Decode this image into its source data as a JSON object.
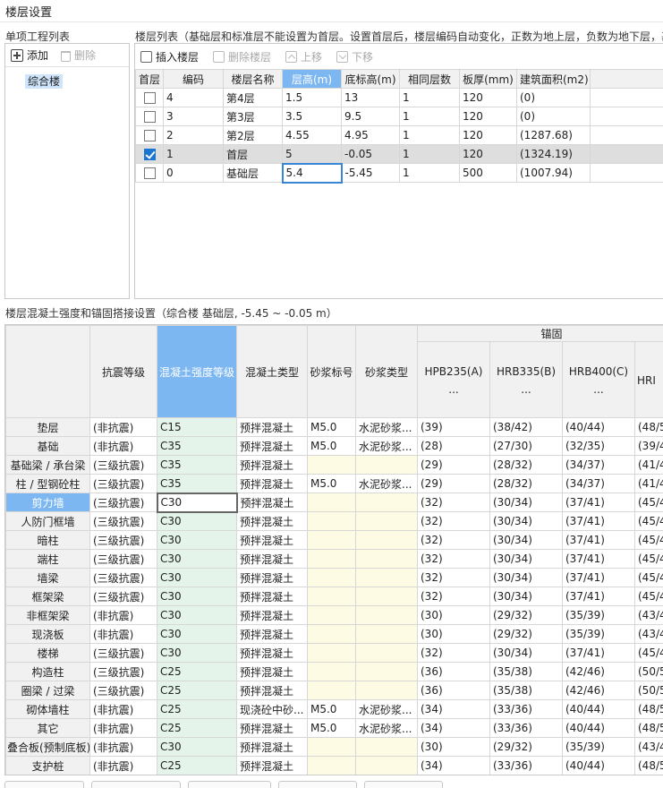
{
  "window": {
    "title": "楼层设置"
  },
  "left_panel": {
    "label": "单项工程列表",
    "add_label": "添加",
    "delete_label": "删除",
    "items": [
      "综合楼"
    ]
  },
  "floor_panel": {
    "label": "楼层列表（基础层和标准层不能设置为首层。设置首层后，楼层编码自动变化，正数为地上层，负数为地下层，基",
    "toolbar": {
      "insert": "插入楼层",
      "delete": "删除楼层",
      "up": "上移",
      "down": "下移"
    },
    "headers": [
      "首层",
      "编码",
      "楼层名称",
      "层高(m)",
      "底标高(m)",
      "相同层数",
      "板厚(mm)",
      "建筑面积(m2)"
    ],
    "rows": [
      {
        "first": false,
        "code": "4",
        "name": "第4层",
        "height": "1.5",
        "base": "13",
        "same": "1",
        "slab": "120",
        "area": "(0)"
      },
      {
        "first": false,
        "code": "3",
        "name": "第3层",
        "height": "3.5",
        "base": "9.5",
        "same": "1",
        "slab": "120",
        "area": "(0)"
      },
      {
        "first": false,
        "code": "2",
        "name": "第2层",
        "height": "4.55",
        "base": "4.95",
        "same": "1",
        "slab": "120",
        "area": "(1287.68)"
      },
      {
        "first": true,
        "code": "1",
        "name": "首层",
        "height": "5",
        "base": "-0.05",
        "same": "1",
        "slab": "120",
        "area": "(1324.19)"
      },
      {
        "first": false,
        "code": "0",
        "name": "基础层",
        "height": "5.4",
        "base": "-5.45",
        "same": "1",
        "slab": "500",
        "area": "(1007.94)"
      }
    ]
  },
  "concrete": {
    "label": "楼层混凝土强度和锚固搭接设置（综合楼  基础层, -5.45 ~ -0.05 m）",
    "group_header": "锚固",
    "headers": [
      "抗震等级",
      "混凝土强度等级",
      "混凝土类型",
      "砂浆标号",
      "砂浆类型",
      "HPB235(A)\n...",
      "HRB335(B)\n...",
      "HRB400(C)\n...",
      "HRI"
    ],
    "rows": [
      [
        "垫层",
        "(非抗震)",
        "C15",
        "预拌混凝土",
        "M5.0",
        "水泥砂浆...",
        "(39)",
        "(38/42)",
        "(40/44)",
        "(48/5"
      ],
      [
        "基础",
        "(非抗震)",
        "C35",
        "预拌混凝土",
        "M5.0",
        "水泥砂浆...",
        "(28)",
        "(27/30)",
        "(32/35)",
        "(39/4"
      ],
      [
        "基础梁 / 承台梁",
        "(三级抗震)",
        "C35",
        "预拌混凝土",
        "",
        "",
        "(29)",
        "(28/32)",
        "(34/37)",
        "(41/4"
      ],
      [
        "柱 / 型钢砼柱",
        "(三级抗震)",
        "C35",
        "预拌混凝土",
        "M5.0",
        "水泥砂浆...",
        "(29)",
        "(28/32)",
        "(34/37)",
        "(41/4"
      ],
      [
        "剪力墙",
        "(三级抗震)",
        "C30",
        "预拌混凝土",
        "",
        "",
        "(32)",
        "(30/34)",
        "(37/41)",
        "(45/4"
      ],
      [
        "人防门框墙",
        "(三级抗震)",
        "C30",
        "预拌混凝土",
        "",
        "",
        "(32)",
        "(30/34)",
        "(37/41)",
        "(45/4"
      ],
      [
        "暗柱",
        "(三级抗震)",
        "C30",
        "预拌混凝土",
        "",
        "",
        "(32)",
        "(30/34)",
        "(37/41)",
        "(45/4"
      ],
      [
        "端柱",
        "(三级抗震)",
        "C30",
        "预拌混凝土",
        "",
        "",
        "(32)",
        "(30/34)",
        "(37/41)",
        "(45/4"
      ],
      [
        "墙梁",
        "(三级抗震)",
        "C30",
        "预拌混凝土",
        "",
        "",
        "(32)",
        "(30/34)",
        "(37/41)",
        "(45/4"
      ],
      [
        "框架梁",
        "(三级抗震)",
        "C30",
        "预拌混凝土",
        "",
        "",
        "(32)",
        "(30/34)",
        "(37/41)",
        "(45/4"
      ],
      [
        "非框架梁",
        "(非抗震)",
        "C30",
        "预拌混凝土",
        "",
        "",
        "(30)",
        "(29/32)",
        "(35/39)",
        "(43/4"
      ],
      [
        "现浇板",
        "(非抗震)",
        "C30",
        "预拌混凝土",
        "",
        "",
        "(30)",
        "(29/32)",
        "(35/39)",
        "(43/4"
      ],
      [
        "楼梯",
        "(三级抗震)",
        "C30",
        "预拌混凝土",
        "",
        "",
        "(32)",
        "(30/34)",
        "(37/41)",
        "(45/4"
      ],
      [
        "构造柱",
        "(三级抗震)",
        "C25",
        "预拌混凝土",
        "",
        "",
        "(36)",
        "(35/38)",
        "(42/46)",
        "(50/5"
      ],
      [
        "圈梁 / 过梁",
        "(三级抗震)",
        "C25",
        "预拌混凝土",
        "",
        "",
        "(36)",
        "(35/38)",
        "(42/46)",
        "(50/5"
      ],
      [
        "砌体墙柱",
        "(非抗震)",
        "C25",
        "现浇砼中砂...",
        "M5.0",
        "水泥砂浆...",
        "(34)",
        "(33/36)",
        "(40/44)",
        "(48/5"
      ],
      [
        "其它",
        "(非抗震)",
        "C25",
        "预拌混凝土",
        "M5.0",
        "水泥砂浆...",
        "(34)",
        "(33/36)",
        "(40/44)",
        "(48/5"
      ],
      [
        "叠合板(预制底板)",
        "(非抗震)",
        "C30",
        "预拌混凝土",
        "",
        "",
        "(30)",
        "(29/32)",
        "(35/39)",
        "(43/4"
      ],
      [
        "支护桩",
        "(非抗震)",
        "C25",
        "预拌混凝土",
        "",
        "",
        "(34)",
        "(33/36)",
        "(40/44)",
        "(48/5"
      ]
    ]
  }
}
